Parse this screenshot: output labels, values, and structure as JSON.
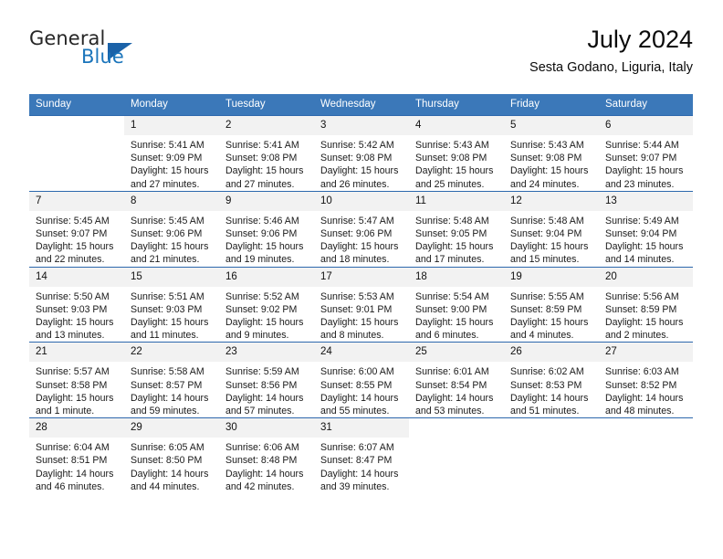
{
  "brand": {
    "name_part1": "General",
    "name_part2": "Blue",
    "triangle_color": "#1b62a8",
    "blue_color": "#1b75bb"
  },
  "header": {
    "title": "July 2024",
    "subtitle": "Sesta Godano, Liguria, Italy"
  },
  "theme": {
    "header_blue": "#3b78b9",
    "row_border_blue": "#2d68ad",
    "daynum_bg": "#f2f2f2"
  },
  "calendar": {
    "weekday_headers": [
      "Sunday",
      "Monday",
      "Tuesday",
      "Wednesday",
      "Thursday",
      "Friday",
      "Saturday"
    ],
    "weeks": [
      [
        {
          "day": "",
          "blank": true,
          "lines": []
        },
        {
          "day": "1",
          "lines": [
            "Sunrise: 5:41 AM",
            "Sunset: 9:09 PM",
            "Daylight: 15 hours",
            "and 27 minutes."
          ]
        },
        {
          "day": "2",
          "lines": [
            "Sunrise: 5:41 AM",
            "Sunset: 9:08 PM",
            "Daylight: 15 hours",
            "and 27 minutes."
          ]
        },
        {
          "day": "3",
          "lines": [
            "Sunrise: 5:42 AM",
            "Sunset: 9:08 PM",
            "Daylight: 15 hours",
            "and 26 minutes."
          ]
        },
        {
          "day": "4",
          "lines": [
            "Sunrise: 5:43 AM",
            "Sunset: 9:08 PM",
            "Daylight: 15 hours",
            "and 25 minutes."
          ]
        },
        {
          "day": "5",
          "lines": [
            "Sunrise: 5:43 AM",
            "Sunset: 9:08 PM",
            "Daylight: 15 hours",
            "and 24 minutes."
          ]
        },
        {
          "day": "6",
          "lines": [
            "Sunrise: 5:44 AM",
            "Sunset: 9:07 PM",
            "Daylight: 15 hours",
            "and 23 minutes."
          ]
        }
      ],
      [
        {
          "day": "7",
          "lines": [
            "Sunrise: 5:45 AM",
            "Sunset: 9:07 PM",
            "Daylight: 15 hours",
            "and 22 minutes."
          ]
        },
        {
          "day": "8",
          "lines": [
            "Sunrise: 5:45 AM",
            "Sunset: 9:06 PM",
            "Daylight: 15 hours",
            "and 21 minutes."
          ]
        },
        {
          "day": "9",
          "lines": [
            "Sunrise: 5:46 AM",
            "Sunset: 9:06 PM",
            "Daylight: 15 hours",
            "and 19 minutes."
          ]
        },
        {
          "day": "10",
          "lines": [
            "Sunrise: 5:47 AM",
            "Sunset: 9:06 PM",
            "Daylight: 15 hours",
            "and 18 minutes."
          ]
        },
        {
          "day": "11",
          "lines": [
            "Sunrise: 5:48 AM",
            "Sunset: 9:05 PM",
            "Daylight: 15 hours",
            "and 17 minutes."
          ]
        },
        {
          "day": "12",
          "lines": [
            "Sunrise: 5:48 AM",
            "Sunset: 9:04 PM",
            "Daylight: 15 hours",
            "and 15 minutes."
          ]
        },
        {
          "day": "13",
          "lines": [
            "Sunrise: 5:49 AM",
            "Sunset: 9:04 PM",
            "Daylight: 15 hours",
            "and 14 minutes."
          ]
        }
      ],
      [
        {
          "day": "14",
          "lines": [
            "Sunrise: 5:50 AM",
            "Sunset: 9:03 PM",
            "Daylight: 15 hours",
            "and 13 minutes."
          ]
        },
        {
          "day": "15",
          "lines": [
            "Sunrise: 5:51 AM",
            "Sunset: 9:03 PM",
            "Daylight: 15 hours",
            "and 11 minutes."
          ]
        },
        {
          "day": "16",
          "lines": [
            "Sunrise: 5:52 AM",
            "Sunset: 9:02 PM",
            "Daylight: 15 hours",
            "and 9 minutes."
          ]
        },
        {
          "day": "17",
          "lines": [
            "Sunrise: 5:53 AM",
            "Sunset: 9:01 PM",
            "Daylight: 15 hours",
            "and 8 minutes."
          ]
        },
        {
          "day": "18",
          "lines": [
            "Sunrise: 5:54 AM",
            "Sunset: 9:00 PM",
            "Daylight: 15 hours",
            "and 6 minutes."
          ]
        },
        {
          "day": "19",
          "lines": [
            "Sunrise: 5:55 AM",
            "Sunset: 8:59 PM",
            "Daylight: 15 hours",
            "and 4 minutes."
          ]
        },
        {
          "day": "20",
          "lines": [
            "Sunrise: 5:56 AM",
            "Sunset: 8:59 PM",
            "Daylight: 15 hours",
            "and 2 minutes."
          ]
        }
      ],
      [
        {
          "day": "21",
          "lines": [
            "Sunrise: 5:57 AM",
            "Sunset: 8:58 PM",
            "Daylight: 15 hours",
            "and 1 minute."
          ]
        },
        {
          "day": "22",
          "lines": [
            "Sunrise: 5:58 AM",
            "Sunset: 8:57 PM",
            "Daylight: 14 hours",
            "and 59 minutes."
          ]
        },
        {
          "day": "23",
          "lines": [
            "Sunrise: 5:59 AM",
            "Sunset: 8:56 PM",
            "Daylight: 14 hours",
            "and 57 minutes."
          ]
        },
        {
          "day": "24",
          "lines": [
            "Sunrise: 6:00 AM",
            "Sunset: 8:55 PM",
            "Daylight: 14 hours",
            "and 55 minutes."
          ]
        },
        {
          "day": "25",
          "lines": [
            "Sunrise: 6:01 AM",
            "Sunset: 8:54 PM",
            "Daylight: 14 hours",
            "and 53 minutes."
          ]
        },
        {
          "day": "26",
          "lines": [
            "Sunrise: 6:02 AM",
            "Sunset: 8:53 PM",
            "Daylight: 14 hours",
            "and 51 minutes."
          ]
        },
        {
          "day": "27",
          "lines": [
            "Sunrise: 6:03 AM",
            "Sunset: 8:52 PM",
            "Daylight: 14 hours",
            "and 48 minutes."
          ]
        }
      ],
      [
        {
          "day": "28",
          "lines": [
            "Sunrise: 6:04 AM",
            "Sunset: 8:51 PM",
            "Daylight: 14 hours",
            "and 46 minutes."
          ]
        },
        {
          "day": "29",
          "lines": [
            "Sunrise: 6:05 AM",
            "Sunset: 8:50 PM",
            "Daylight: 14 hours",
            "and 44 minutes."
          ]
        },
        {
          "day": "30",
          "lines": [
            "Sunrise: 6:06 AM",
            "Sunset: 8:48 PM",
            "Daylight: 14 hours",
            "and 42 minutes."
          ]
        },
        {
          "day": "31",
          "lines": [
            "Sunrise: 6:07 AM",
            "Sunset: 8:47 PM",
            "Daylight: 14 hours",
            "and 39 minutes."
          ]
        },
        {
          "day": "",
          "blank": true,
          "lines": []
        },
        {
          "day": "",
          "blank": true,
          "lines": []
        },
        {
          "day": "",
          "blank": true,
          "lines": []
        }
      ]
    ]
  }
}
